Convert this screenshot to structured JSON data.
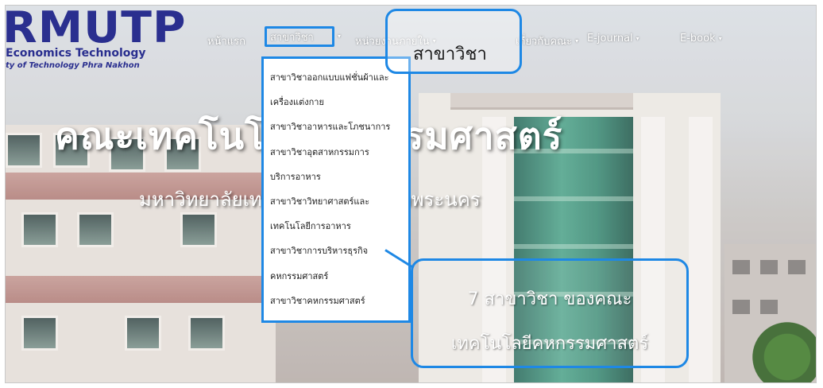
{
  "logo": {
    "mark": "RMUTP",
    "line1": "Economics Technology",
    "line2": "ty of Technology Phra Nakhon"
  },
  "nav": {
    "items": [
      {
        "label": "หน้าแรก"
      },
      {
        "label": "สาขาวิชา"
      },
      {
        "label": "หน่วยงานภายใน"
      },
      {
        "label": "เกี่ยวกับคณะ"
      },
      {
        "label": "E-journal"
      },
      {
        "label": "E-book"
      }
    ]
  },
  "hero": {
    "title": "คณะเทคโนโลยีคหกรรมศาสตร์",
    "subtitle": "มหาวิทยาลัยเทคโนโลยีราชมงคลพระนคร"
  },
  "dropdown": {
    "items": [
      "สาขาวิชาออกแบบแฟชั่นผ้าและ",
      "เครื่องแต่งกาย",
      "สาขาวิชาอาหารและโภชนาการ",
      "สาขาวิชาอุตสาหกรรมการ",
      "บริการอาหาร",
      "สาขาวิชาวิทยาศาสตร์และ",
      "เทคโนโลยีการอาหาร",
      "สาขาวิชาการบริหารธุรกิจ",
      "คหกรรมศาสตร์",
      "สาขาวิชาคหกรรมศาสตร์"
    ]
  },
  "callouts": {
    "top": "สาขาวิชา",
    "bottom_line1": "7 สาขาวิชา ของคณะ",
    "bottom_line2": "เทคโนโลยีคหกรรมศาสตร์"
  },
  "colors": {
    "accent": "#1e88e5",
    "logo": "#2a2f8f"
  }
}
